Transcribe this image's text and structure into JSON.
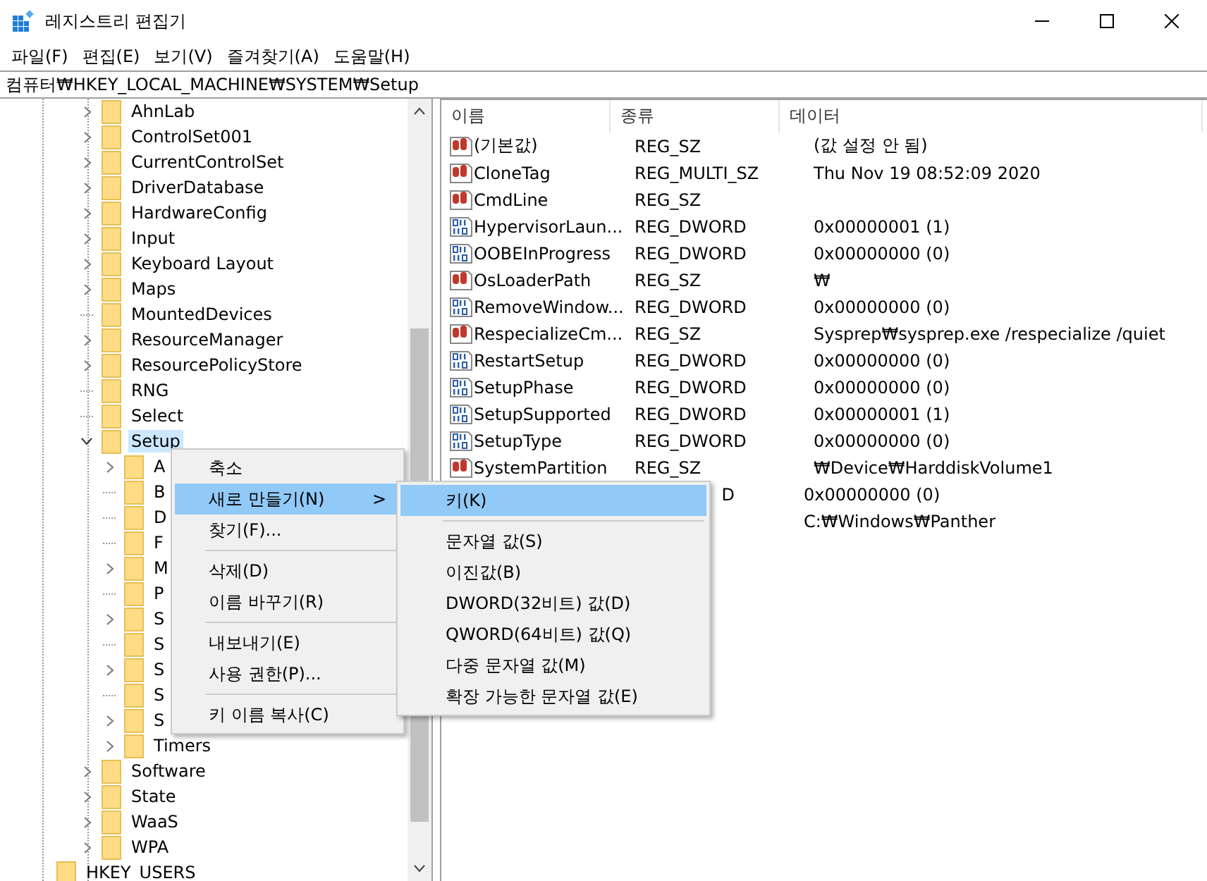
{
  "window": {
    "title": "레지스트리 편집기"
  },
  "menu_bar": [
    "파일(F)",
    "편집(E)",
    "보기(V)",
    "즐겨찾기(A)",
    "도움말(H)"
  ],
  "address_bar": {
    "value": "컴퓨터₩HKEY_LOCAL_MACHINE₩SYSTEM₩Setup"
  },
  "tree": [
    {
      "label": "AhnLab",
      "kind": "branch",
      "expanded": false,
      "selected": false
    },
    {
      "label": "ControlSet001",
      "kind": "branch",
      "expanded": false,
      "selected": false
    },
    {
      "label": "CurrentControlSet",
      "kind": "branch",
      "expanded": false,
      "selected": false
    },
    {
      "label": "DriverDatabase",
      "kind": "branch",
      "expanded": false,
      "selected": false
    },
    {
      "label": "HardwareConfig",
      "kind": "branch",
      "expanded": false,
      "selected": false
    },
    {
      "label": "Input",
      "kind": "branch",
      "expanded": false,
      "selected": false
    },
    {
      "label": "Keyboard Layout",
      "kind": "branch",
      "expanded": false,
      "selected": false
    },
    {
      "label": "Maps",
      "kind": "branch",
      "expanded": false,
      "selected": false
    },
    {
      "label": "MountedDevices",
      "kind": "leaf",
      "selected": false
    },
    {
      "label": "ResourceManager",
      "kind": "branch",
      "expanded": false,
      "selected": false
    },
    {
      "label": "ResourcePolicyStore",
      "kind": "branch",
      "expanded": false,
      "selected": false
    },
    {
      "label": "RNG",
      "kind": "leaf",
      "selected": false
    },
    {
      "label": "Select",
      "kind": "leaf",
      "selected": false
    },
    {
      "label": "Setup",
      "kind": "branch",
      "expanded": true,
      "selected": true,
      "children": [
        {
          "label": "A",
          "kind": "branch",
          "expanded": false,
          "selected": false
        },
        {
          "label": "B",
          "kind": "leaf",
          "selected": false
        },
        {
          "label": "D",
          "kind": "leaf",
          "selected": false
        },
        {
          "label": "F",
          "kind": "leaf",
          "selected": false
        },
        {
          "label": "M",
          "kind": "branch",
          "expanded": false,
          "selected": false
        },
        {
          "label": "P",
          "kind": "leaf",
          "selected": false
        },
        {
          "label": "S",
          "kind": "branch",
          "expanded": false,
          "selected": false
        },
        {
          "label": "S",
          "kind": "leaf",
          "selected": false
        },
        {
          "label": "S",
          "kind": "branch",
          "expanded": false,
          "selected": false
        },
        {
          "label": "S",
          "kind": "leaf",
          "selected": false
        },
        {
          "label": "S",
          "kind": "branch",
          "expanded": false,
          "selected": false
        },
        {
          "label": "Timers",
          "kind": "branch",
          "expanded": false,
          "selected": false
        }
      ]
    },
    {
      "label": "Software",
      "kind": "branch",
      "expanded": false,
      "selected": false
    },
    {
      "label": "State",
      "kind": "branch",
      "expanded": false,
      "selected": false
    },
    {
      "label": "WaaS",
      "kind": "branch",
      "expanded": false,
      "selected": false
    },
    {
      "label": "WPA",
      "kind": "branch",
      "expanded": false,
      "selected": false
    }
  ],
  "tree_root_item": {
    "label": "HKEY_USERS"
  },
  "table": {
    "columns": [
      "이름",
      "종류",
      "데이터"
    ],
    "rows": [
      {
        "kind": "sz",
        "name": "(기본값)",
        "type": "REG_SZ",
        "data": "(값 설정 안 됨)"
      },
      {
        "kind": "sz",
        "name": "CloneTag",
        "type": "REG_MULTI_SZ",
        "data": "Thu Nov 19 08:52:09 2020"
      },
      {
        "kind": "sz",
        "name": "CmdLine",
        "type": "REG_SZ"
      },
      {
        "kind": "dword",
        "name": "HypervisorLaun...",
        "type": "REG_DWORD",
        "data": "0x00000001 (1)"
      },
      {
        "kind": "dword",
        "name": "OOBEInProgress",
        "type": "REG_DWORD",
        "data": "0x00000000 (0)"
      },
      {
        "kind": "sz",
        "name": "OsLoaderPath",
        "type": "REG_SZ",
        "data": "₩"
      },
      {
        "kind": "dword",
        "name": "RemoveWindow...",
        "type": "REG_DWORD",
        "data": "0x00000000 (0)"
      },
      {
        "kind": "sz",
        "name": "RespecializeCm...",
        "type": "REG_SZ",
        "data": "Sysprep₩sysprep.exe /respecialize /quiet"
      },
      {
        "kind": "dword",
        "name": "RestartSetup",
        "type": "REG_DWORD",
        "data": "0x00000000 (0)"
      },
      {
        "kind": "dword",
        "name": "SetupPhase",
        "type": "REG_DWORD",
        "data": "0x00000000 (0)"
      },
      {
        "kind": "dword",
        "name": "SetupSupported",
        "type": "REG_DWORD",
        "data": "0x00000001 (1)"
      },
      {
        "kind": "dword",
        "name": "SetupType",
        "type": "REG_DWORD",
        "data": "0x00000000 (0)"
      },
      {
        "kind": "sz",
        "name": "SystemPartition",
        "type": "REG_SZ",
        "data": "₩Device₩HarddiskVolume1"
      },
      {
        "type": "D",
        "data": "0x00000000 (0)"
      },
      {
        "data": "C:₩Windows₩Panther"
      }
    ]
  },
  "context_menu": [
    {
      "kind": "item",
      "label": "축소",
      "selected": false
    },
    {
      "kind": "item",
      "label": "새로 만들기(N)",
      "selected": true,
      "submenu_arrow": ">"
    },
    {
      "kind": "item",
      "label": "찾기(F)...",
      "selected": false
    },
    {
      "kind": "separator"
    },
    {
      "kind": "item",
      "label": "삭제(D)",
      "selected": false
    },
    {
      "kind": "item",
      "label": "이름 바꾸기(R)",
      "selected": false
    },
    {
      "kind": "separator"
    },
    {
      "kind": "item",
      "label": "내보내기(E)",
      "selected": false
    },
    {
      "kind": "item",
      "label": "사용 권한(P)...",
      "selected": false
    },
    {
      "kind": "separator"
    },
    {
      "kind": "item",
      "label": "키 이름 복사(C)",
      "selected": false
    }
  ],
  "submenu": [
    {
      "kind": "item",
      "label": "키(K)",
      "selected": true
    },
    {
      "kind": "separator"
    },
    {
      "kind": "item",
      "label": "문자열 값(S)",
      "selected": false
    },
    {
      "kind": "item",
      "label": "이진값(B)",
      "selected": false
    },
    {
      "kind": "item",
      "label": "DWORD(32비트) 값(D)",
      "selected": false
    },
    {
      "kind": "item",
      "label": "QWORD(64비트) 값(Q)",
      "selected": false
    },
    {
      "kind": "item",
      "label": "다중 문자열 값(M)",
      "selected": false
    },
    {
      "kind": "item",
      "label": "확장 가능한 문자열 값(E)",
      "selected": false
    }
  ]
}
